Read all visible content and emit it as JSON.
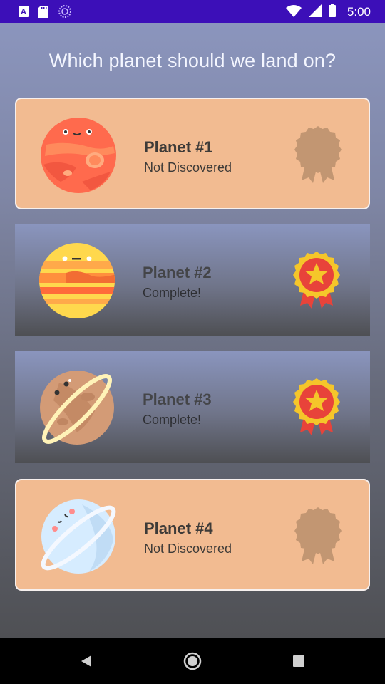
{
  "status_bar": {
    "time": "5:00",
    "left_icons": [
      "a-notification-icon",
      "sd-card-icon",
      "sync-icon"
    ],
    "right_icons": [
      "wifi-icon",
      "signal-icon",
      "battery-icon"
    ],
    "background_color": "#3c0fb8"
  },
  "page": {
    "title": "Which planet should we land on?"
  },
  "planets": [
    {
      "title": "Planet #1",
      "status": "Not Discovered",
      "state": "locked",
      "icon": "red-planet-icon",
      "medal": "locked-medal-icon"
    },
    {
      "title": "Planet #2",
      "status": "Complete!",
      "state": "complete",
      "icon": "striped-planet-icon",
      "medal": "gold-medal-icon"
    },
    {
      "title": "Planet #3",
      "status": "Complete!",
      "state": "complete",
      "icon": "ringed-brown-planet-icon",
      "medal": "gold-medal-icon"
    },
    {
      "title": "Planet #4",
      "status": "Not Discovered",
      "state": "locked",
      "icon": "ringed-blue-planet-icon",
      "medal": "locked-medal-icon"
    }
  ],
  "colors": {
    "locked_card": "#f2bb91",
    "medal_gold": "#f5c62a",
    "medal_red": "#e8433a",
    "locked_medal": "#c29672"
  },
  "nav_bar": {
    "buttons": [
      "back-icon",
      "home-icon",
      "recents-icon"
    ]
  }
}
